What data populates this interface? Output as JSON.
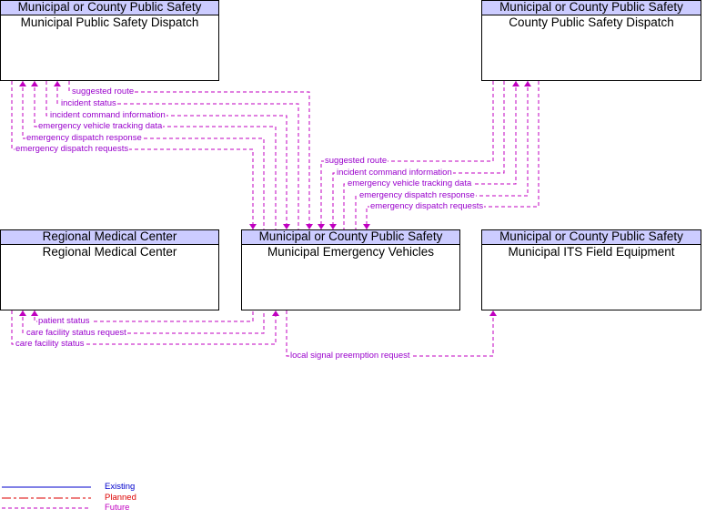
{
  "colors": {
    "future": "#c000c0",
    "existing": "#0000cc",
    "planned": "#dd0000",
    "header_fill": "#ccccff"
  },
  "elements": {
    "muni_dispatch": {
      "category": "Municipal or County Public Safety",
      "name": "Municipal Public Safety Dispatch"
    },
    "county_dispatch": {
      "category": "Municipal or County Public Safety",
      "name": "County Public Safety Dispatch"
    },
    "medical": {
      "category": "Regional Medical Center",
      "name": "Regional Medical Center"
    },
    "vehicles": {
      "category": "Municipal or County Public Safety",
      "name": "Municipal Emergency Vehicles"
    },
    "its_field": {
      "category": "Municipal or County Public Safety",
      "name": "Municipal ITS Field Equipment"
    }
  },
  "flows": {
    "muni": [
      {
        "label": "suggested route",
        "to": "vehicles",
        "status": "future"
      },
      {
        "label": "incident status",
        "to": "muni_dispatch",
        "status": "future"
      },
      {
        "label": "incident command information",
        "to": "vehicles",
        "status": "future"
      },
      {
        "label": "emergency vehicle tracking data",
        "to": "muni_dispatch",
        "status": "future"
      },
      {
        "label": "emergency dispatch response",
        "to": "muni_dispatch",
        "status": "future"
      },
      {
        "label": "emergency dispatch requests",
        "to": "vehicles",
        "status": "future"
      }
    ],
    "county": [
      {
        "label": "suggested route",
        "to": "vehicles",
        "status": "future"
      },
      {
        "label": "incident command information",
        "to": "vehicles",
        "status": "future"
      },
      {
        "label": "emergency vehicle tracking data",
        "to": "county_dispatch",
        "status": "future"
      },
      {
        "label": "emergency dispatch response",
        "to": "county_dispatch",
        "status": "future"
      },
      {
        "label": "emergency dispatch requests",
        "to": "vehicles",
        "status": "future"
      }
    ],
    "medical": [
      {
        "label": "patient status",
        "to": "medical",
        "status": "future"
      },
      {
        "label": "care facility status request",
        "to": "medical",
        "status": "future"
      },
      {
        "label": "care facility status",
        "to": "vehicles",
        "status": "future"
      }
    ],
    "its": [
      {
        "label": "local signal preemption request",
        "to": "its_field",
        "status": "future"
      }
    ]
  },
  "legend": {
    "existing": "Existing",
    "planned": "Planned",
    "future": "Future"
  }
}
